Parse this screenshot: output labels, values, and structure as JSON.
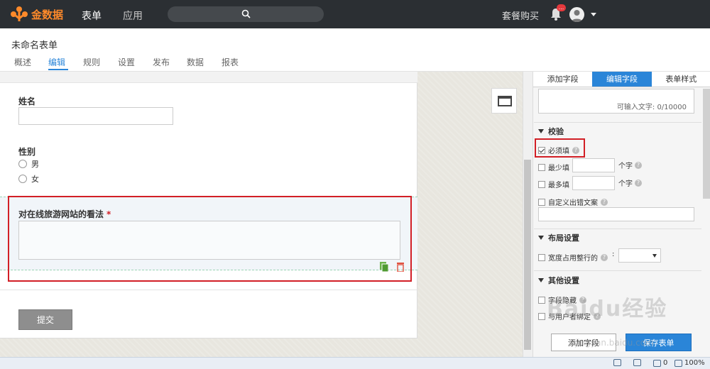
{
  "header": {
    "logo_text": "金数据",
    "nav": [
      "表单",
      "应用"
    ],
    "search_placeholder": "",
    "plan_link": "套餐购买",
    "badge": "..."
  },
  "form": {
    "title": "未命名表单",
    "tabs": [
      "概述",
      "编辑",
      "规则",
      "设置",
      "发布",
      "数据",
      "报表"
    ],
    "active_tab": "编辑",
    "fields": {
      "name_label": "姓名",
      "gender_label": "性别",
      "gender_options": [
        "男",
        "女"
      ],
      "opinion_label": "对在线旅游网站的看法",
      "required_mark": "*"
    },
    "submit_label": "提交"
  },
  "right_panel": {
    "tabs": [
      "添加字段",
      "编辑字段",
      "表单样式"
    ],
    "active_tab": "编辑字段",
    "char_counter": "可输入文字: 0/10000",
    "validation": {
      "title": "校验",
      "required": "必须填",
      "required_checked": true,
      "min_label": "最少填",
      "max_label": "最多填",
      "unit": "个字",
      "custom_error": "自定义出错文案"
    },
    "layout": {
      "title": "布局设置",
      "width_label": "宽度占用整行的",
      "colon": ":"
    },
    "other": {
      "title": "其他设置",
      "hide_field": "字段隐藏",
      "partial_text": "与用户者绑定"
    },
    "add_field_button": "添加字段",
    "save_button": "保存表单"
  },
  "watermark": {
    "main": "Baidu经验",
    "sub": "jingyan.baidu.com"
  },
  "statusbar": {
    "count": "0",
    "zoom": "100%"
  },
  "colors": {
    "accent": "#2a85d8",
    "brand": "#ff8a2a",
    "highlight": "#d21f26",
    "topbar": "#2b2f33"
  }
}
